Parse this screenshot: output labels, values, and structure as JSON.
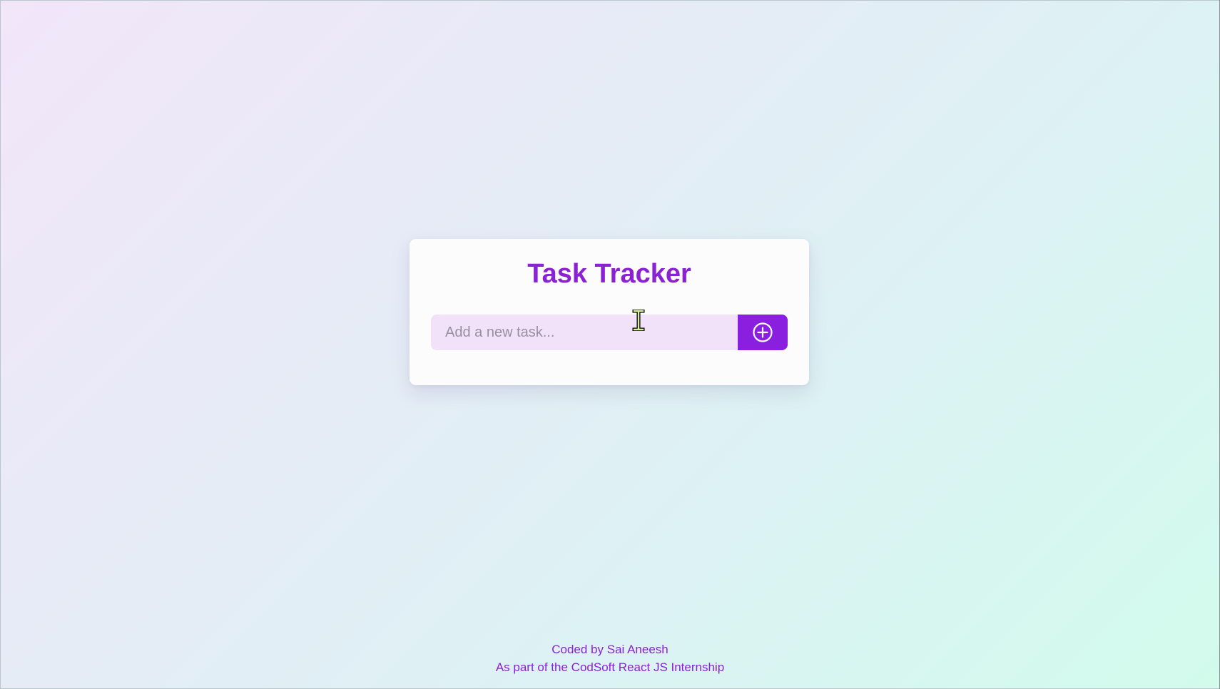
{
  "app": {
    "title": "Task Tracker"
  },
  "task_input": {
    "placeholder": "Add a new task...",
    "value": ""
  },
  "add_button": {
    "icon": "plus-circle-icon"
  },
  "footer": {
    "line1": "Coded by Sai Aneesh",
    "line2": "As part of the CodSoft React JS Internship"
  },
  "colors": {
    "accent": "#8a22d4",
    "button": "#8b1fe0",
    "input_bg": "#f1e2fa",
    "card_bg": "#fdfcfc"
  }
}
